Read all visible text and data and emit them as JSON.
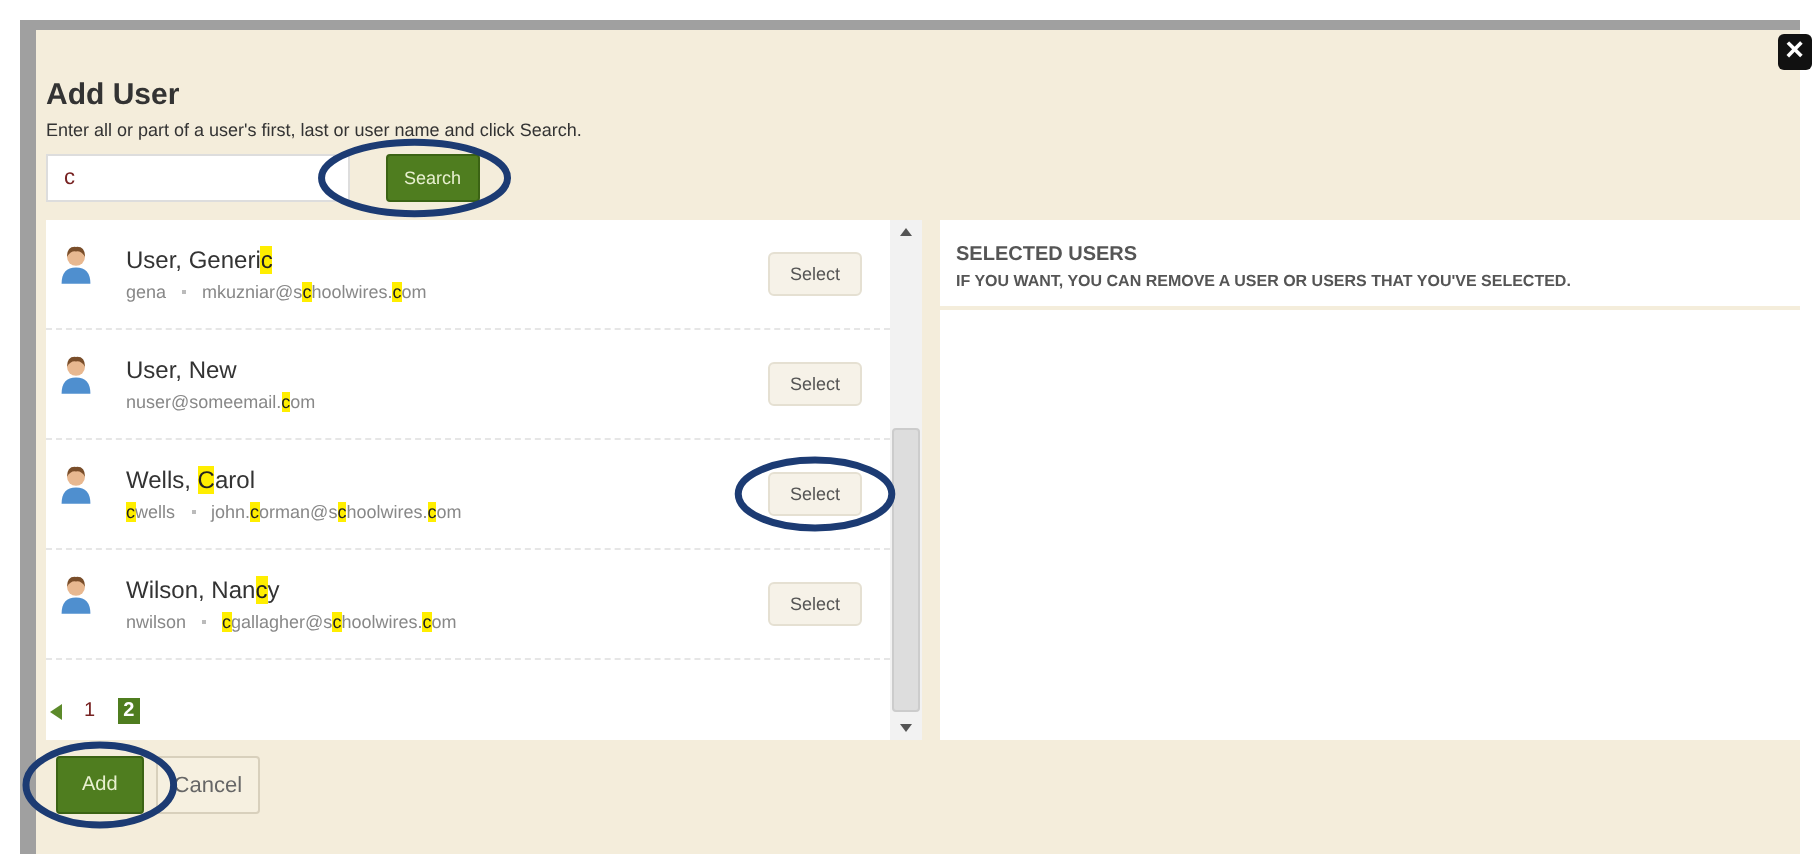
{
  "dialog": {
    "title": "Add User",
    "instructions": "Enter all or part of a user's first, last or user name and click Search.",
    "close_label": "×"
  },
  "search": {
    "value": "c",
    "button": "Search",
    "circled": true
  },
  "users": [
    {
      "name": [
        {
          "t": "User, Generi",
          "hl": false
        },
        {
          "t": "c",
          "hl": true
        }
      ],
      "username": [
        {
          "t": "gena",
          "hl": false
        }
      ],
      "email": [
        {
          "t": "mkuzniar@s",
          "hl": false
        },
        {
          "t": "c",
          "hl": true
        },
        {
          "t": "hoolwires.",
          "hl": false
        },
        {
          "t": "c",
          "hl": true
        },
        {
          "t": "om",
          "hl": false
        }
      ],
      "button": "Select",
      "circled": false
    },
    {
      "name": [
        {
          "t": "User, New",
          "hl": false
        }
      ],
      "email": [
        {
          "t": "nuser@someemail.",
          "hl": false
        },
        {
          "t": "c",
          "hl": true
        },
        {
          "t": "om",
          "hl": false
        }
      ],
      "button": "Select",
      "circled": false
    },
    {
      "name": [
        {
          "t": "Wells, ",
          "hl": false
        },
        {
          "t": "C",
          "hl": true
        },
        {
          "t": "arol",
          "hl": false
        }
      ],
      "username": [
        {
          "t": "c",
          "hl": true
        },
        {
          "t": "wells",
          "hl": false
        }
      ],
      "email": [
        {
          "t": "john.",
          "hl": false
        },
        {
          "t": "c",
          "hl": true
        },
        {
          "t": "orman@s",
          "hl": false
        },
        {
          "t": "c",
          "hl": true
        },
        {
          "t": "hoolwires.",
          "hl": false
        },
        {
          "t": "c",
          "hl": true
        },
        {
          "t": "om",
          "hl": false
        }
      ],
      "button": "Select",
      "circled": true
    },
    {
      "name": [
        {
          "t": "Wilson, Nan",
          "hl": false
        },
        {
          "t": "c",
          "hl": true
        },
        {
          "t": "y",
          "hl": false
        }
      ],
      "username": [
        {
          "t": "nwilson",
          "hl": false
        }
      ],
      "email": [
        {
          "t": "c",
          "hl": true
        },
        {
          "t": "gallagher@s",
          "hl": false
        },
        {
          "t": "c",
          "hl": true
        },
        {
          "t": "hoolwires.",
          "hl": false
        },
        {
          "t": "c",
          "hl": true
        },
        {
          "t": "om",
          "hl": false
        }
      ],
      "button": "Select",
      "circled": false
    }
  ],
  "pages": [
    {
      "label": "1",
      "selected": false
    },
    {
      "label": "2",
      "selected": true
    }
  ],
  "selected_panel": {
    "title": "SELECTED USERS",
    "subtitle": "IF YOU WANT, YOU CAN REMOVE A USER OR USERS THAT YOU'VE SELECTED."
  },
  "footer": {
    "add": "Add",
    "add_circled": true,
    "cancel": "Cancel"
  }
}
